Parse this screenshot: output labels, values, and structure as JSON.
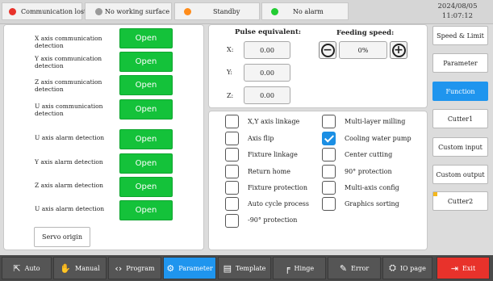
{
  "status": {
    "items": [
      {
        "label": "Communication lost",
        "color": "#e8322b"
      },
      {
        "label": "No working surface",
        "color": "#9a9a9a"
      },
      {
        "label": "Standby",
        "color": "#ff8c1a"
      },
      {
        "label": "No alarm",
        "color": "#22cc33"
      }
    ],
    "date": "2024/08/05",
    "time": "11:07:12"
  },
  "detection": {
    "rows": [
      {
        "label": "X axis communication detection",
        "button": "Open"
      },
      {
        "label": "Y axis communication detection",
        "button": "Open"
      },
      {
        "label": "Z axis communication detection",
        "button": "Open"
      },
      {
        "label": "U axis communication detection",
        "button": "Open"
      },
      {
        "label": "U axis alarm detection",
        "button": "Open"
      },
      {
        "label": "Y axis alarm detection",
        "button": "Open"
      },
      {
        "label": "Z axis alarm detection",
        "button": "Open"
      },
      {
        "label": "U axis alarm detection",
        "button": "Open"
      }
    ],
    "servo_origin": "Servo origin"
  },
  "pulse": {
    "title": "Pulse equivalent:",
    "x_label": "X:",
    "y_label": "Y:",
    "z_label": "Z:",
    "x_value": "0.00",
    "y_value": "0.00",
    "z_value": "0.00"
  },
  "feeding": {
    "title": "Feeding speed:",
    "value": "0%",
    "minus": "−",
    "plus": "+"
  },
  "options": {
    "left": [
      {
        "label": "X,Y axis linkage",
        "checked": false
      },
      {
        "label": "Axis flip",
        "checked": false
      },
      {
        "label": "Fixture linkage",
        "checked": false
      },
      {
        "label": "Return home",
        "checked": false
      },
      {
        "label": "Fixture protection",
        "checked": false
      },
      {
        "label": "Auto cycle process",
        "checked": false
      },
      {
        "label": "-90°  protection",
        "checked": false
      }
    ],
    "right": [
      {
        "label": "Multi-layer milling",
        "checked": false
      },
      {
        "label": "Cooling water pump",
        "checked": true
      },
      {
        "label": "Center cutting",
        "checked": false
      },
      {
        "label": "90°  protection",
        "checked": false
      },
      {
        "label": "Multi-axis config",
        "checked": false
      },
      {
        "label": "Graphics sorting",
        "checked": false
      }
    ]
  },
  "side_menu": [
    {
      "label": "Speed & Limit",
      "active": false
    },
    {
      "label": "Parameter",
      "active": false
    },
    {
      "label": "Function",
      "active": true
    },
    {
      "label": "Cutter1",
      "active": false
    },
    {
      "label": "Custom input",
      "active": false
    },
    {
      "label": "Custom output",
      "active": false
    },
    {
      "label": "Cutter2",
      "active": false
    }
  ],
  "bottom_nav": [
    {
      "label": "Auto",
      "icon": "auto-icon"
    },
    {
      "label": "Manual",
      "icon": "hand-icon"
    },
    {
      "label": "Program",
      "icon": "code-icon"
    },
    {
      "label": "Parameter",
      "icon": "gear-icon"
    },
    {
      "label": "Template",
      "icon": "template-icon"
    },
    {
      "label": "Hinge",
      "icon": "hinge-icon"
    },
    {
      "label": "Error",
      "icon": "error-icon"
    },
    {
      "label": "IO page",
      "icon": "io-icon"
    },
    {
      "label": "Exit",
      "icon": "exit-icon"
    }
  ],
  "colors": {
    "accent": "#1f95ee",
    "open_green": "#14c23a",
    "exit_red": "#e8322b",
    "lock_yellow": "#f5b81c"
  }
}
